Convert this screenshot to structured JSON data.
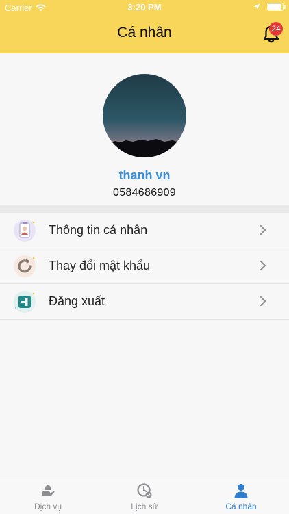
{
  "status_bar": {
    "carrier": "Carrier",
    "time": "3:20 PM"
  },
  "header": {
    "title": "Cá nhân",
    "notification_count": "24"
  },
  "profile": {
    "name": "thanh vn",
    "phone": "0584686909"
  },
  "menu": {
    "items": [
      {
        "label": "Thông tin cá nhân",
        "icon": "id-card-icon"
      },
      {
        "label": "Thay đổi mật khẩu",
        "icon": "refresh-icon"
      },
      {
        "label": "Đăng xuất",
        "icon": "logout-icon"
      }
    ]
  },
  "tabbar": {
    "tabs": [
      {
        "label": "Dịch vụ",
        "icon": "service-hand-icon",
        "active": false
      },
      {
        "label": "Lịch sử",
        "icon": "history-clock-icon",
        "active": false
      },
      {
        "label": "Cá nhân",
        "icon": "person-icon",
        "active": true
      }
    ]
  },
  "colors": {
    "header_bg": "#f7d659",
    "accent_blue": "#3a8fd6",
    "badge_red": "#e53935"
  }
}
